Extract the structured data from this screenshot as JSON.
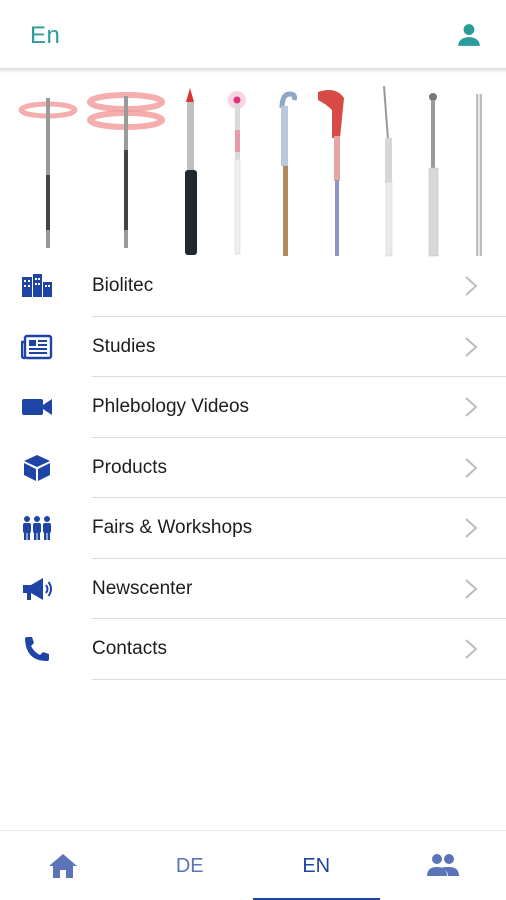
{
  "header": {
    "language_label": "En",
    "user_icon": "user-icon"
  },
  "banner": {
    "description_icon": "laser-fiber-products-banner"
  },
  "menu": {
    "items": [
      {
        "label": "Biolitec",
        "icon": "buildings-icon"
      },
      {
        "label": "Studies",
        "icon": "newspaper-icon"
      },
      {
        "label": "Phlebology Videos",
        "icon": "video-camera-icon"
      },
      {
        "label": "Products",
        "icon": "cube-icon"
      },
      {
        "label": "Fairs & Workshops",
        "icon": "people-group-icon"
      },
      {
        "label": "Newscenter",
        "icon": "megaphone-icon"
      },
      {
        "label": "Contacts",
        "icon": "phone-icon"
      }
    ]
  },
  "bottom_nav": {
    "home_icon": "home-icon",
    "de_label": "DE",
    "en_label": "EN",
    "people_icon": "people-icon",
    "active_tab": "EN"
  },
  "colors": {
    "accent_teal": "#2a9d9a",
    "brand_blue": "#1e44a6",
    "nav_inactive": "#5b74b8"
  }
}
